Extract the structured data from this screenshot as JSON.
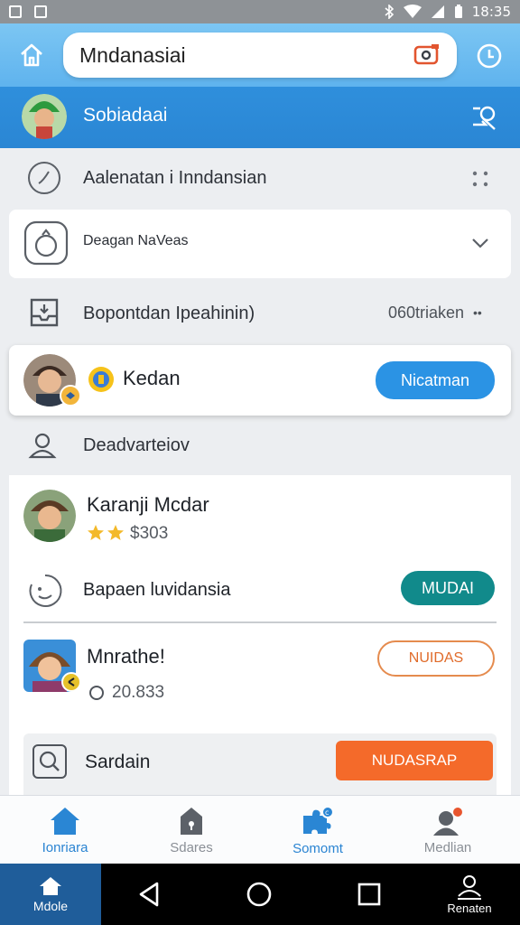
{
  "status_bar": {
    "time": "18:35"
  },
  "search": {
    "value": "Mndanasiai"
  },
  "user": {
    "name": "Sobiadaai"
  },
  "rows": {
    "r1": {
      "label": "Aalenatan i Inndansian"
    },
    "r2": {
      "label": "Deagan NaVeas"
    },
    "r3": {
      "label": "Bopontdan Ipeahinin)",
      "value": "060triaken"
    }
  },
  "feature_card": {
    "name": "Kedan",
    "button": "Nicatman"
  },
  "section_header": {
    "label": "Deadvarteiov"
  },
  "list": {
    "item1": {
      "title": "Karanji Mcdar",
      "rating": 2,
      "price": "$303"
    },
    "item2": {
      "title": "Bapaen luvidansia",
      "button": "MUDAI"
    },
    "item3": {
      "title": "Mnrathe!",
      "value": "20.833",
      "button": "NUIDAS"
    },
    "item4": {
      "title": "Sardain",
      "button": "NUDASRAP"
    }
  },
  "bottom_nav": [
    {
      "label": "Ionriara",
      "icon": "home-icon",
      "active": true
    },
    {
      "label": "Sdares",
      "icon": "lock-icon",
      "active": false
    },
    {
      "label": "Somomt",
      "icon": "puzzle-icon",
      "active": false
    },
    {
      "label": "Medlian",
      "icon": "person-icon",
      "active": false
    }
  ],
  "system_nav": {
    "tab_label": "Mdole",
    "account_label": "Renaten"
  },
  "colors": {
    "accent": "#2b93e4",
    "header": "#5fb3ee",
    "teal": "#118a8b",
    "orange": "#f46a2a"
  }
}
